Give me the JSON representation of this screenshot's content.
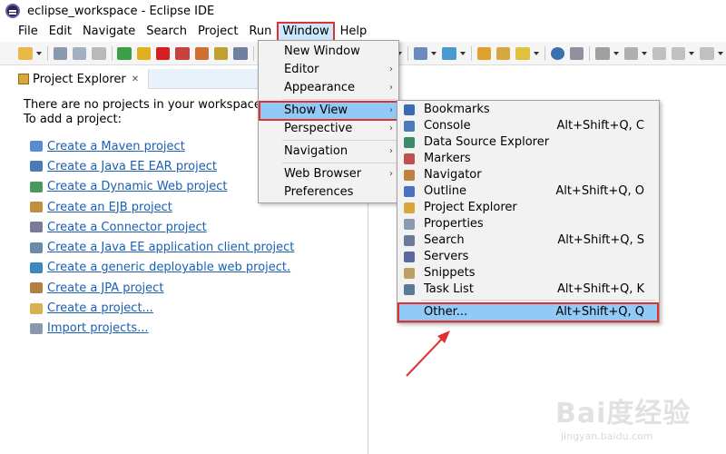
{
  "window": {
    "title": "eclipse_workspace - Eclipse IDE"
  },
  "menubar": [
    "File",
    "Edit",
    "Navigate",
    "Search",
    "Project",
    "Run",
    "Window",
    "Help"
  ],
  "active_menu": "Window",
  "project_explorer": {
    "tab_label": "Project Explorer",
    "close_glyph": "✕",
    "intro_line1": "There are no projects in your workspace.",
    "intro_line2": "To add a project:",
    "links": [
      "Create a Maven project",
      "Create a Java EE EAR project",
      "Create a Dynamic Web project",
      "Create an EJB project",
      "Create a Connector project",
      "Create a Java EE application client project",
      "Create a generic deployable web project.",
      "Create a JPA project",
      "Create a project...",
      "Import projects..."
    ]
  },
  "window_menu": {
    "items": [
      {
        "label": "New Window",
        "submenu": false
      },
      {
        "label": "Editor",
        "submenu": true
      },
      {
        "label": "Appearance",
        "submenu": true
      },
      {
        "label": "Show View",
        "submenu": true,
        "highlighted": true
      },
      {
        "label": "Perspective",
        "submenu": true
      },
      {
        "label": "Navigation",
        "submenu": true
      },
      {
        "label": "Web Browser",
        "submenu": true
      },
      {
        "label": "Preferences",
        "submenu": false
      }
    ],
    "submenu_arrow": "›"
  },
  "show_view_menu": {
    "items": [
      {
        "label": "Bookmarks",
        "shortcut": "",
        "icon": "bookmarks-icon"
      },
      {
        "label": "Console",
        "shortcut": "Alt+Shift+Q, C",
        "icon": "console-icon"
      },
      {
        "label": "Data Source Explorer",
        "shortcut": "",
        "icon": "data-source-icon"
      },
      {
        "label": "Markers",
        "shortcut": "",
        "icon": "markers-icon"
      },
      {
        "label": "Navigator",
        "shortcut": "",
        "icon": "navigator-icon"
      },
      {
        "label": "Outline",
        "shortcut": "Alt+Shift+Q, O",
        "icon": "outline-icon"
      },
      {
        "label": "Project Explorer",
        "shortcut": "",
        "icon": "project-explorer-icon"
      },
      {
        "label": "Properties",
        "shortcut": "",
        "icon": "properties-icon"
      },
      {
        "label": "Search",
        "shortcut": "Alt+Shift+Q, S",
        "icon": "search-icon"
      },
      {
        "label": "Servers",
        "shortcut": "",
        "icon": "servers-icon"
      },
      {
        "label": "Snippets",
        "shortcut": "",
        "icon": "snippets-icon"
      },
      {
        "label": "Task List",
        "shortcut": "Alt+Shift+Q, K",
        "icon": "task-list-icon"
      },
      {
        "label": "Other...",
        "shortcut": "Alt+Shift+Q, Q",
        "icon": "",
        "highlighted": true
      }
    ]
  },
  "colors": {
    "highlight": "#91c9f7",
    "annotation_red": "#e03030",
    "link_blue": "#1a5fb4"
  },
  "watermark": {
    "logo": "Bai度经验",
    "url": "jingyan.baidu.com"
  }
}
